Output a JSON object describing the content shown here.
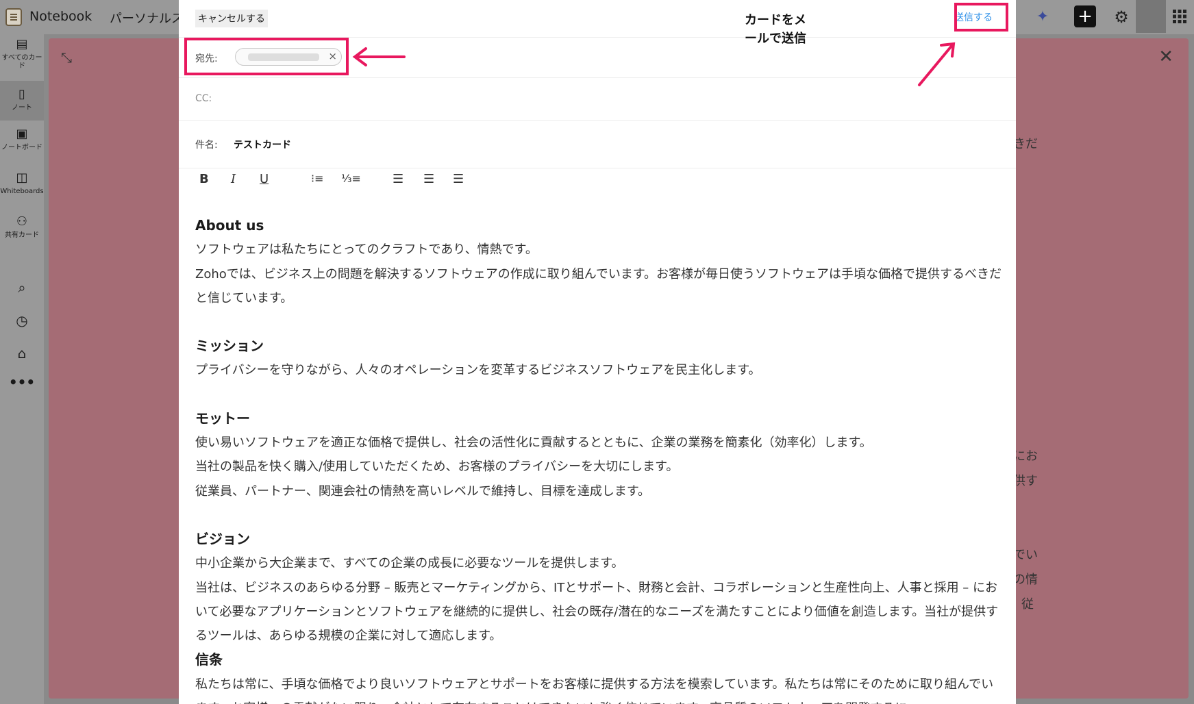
{
  "app": {
    "name": "Notebook",
    "space": "パーソナルスペ"
  },
  "sidebar": {
    "items": [
      {
        "label": "すべてのカード",
        "icon": "all-cards-icon"
      },
      {
        "label": "ノート",
        "icon": "note-icon"
      },
      {
        "label": "ノートボード",
        "icon": "noteboard-icon"
      },
      {
        "label": "Whiteboards",
        "icon": "whiteboard-icon"
      },
      {
        "label": "共有カード",
        "icon": "shared-icon"
      }
    ],
    "tools": [
      "search-icon",
      "alarm-icon",
      "tag-icon",
      "more-icon"
    ]
  },
  "background_card": {
    "fragments": [
      "きだ",
      "にお",
      "供す",
      "でい",
      "の情",
      "従"
    ]
  },
  "compose": {
    "cancel_label": "キャンセルする",
    "send_label": "送信する",
    "to_label": "宛先:",
    "cc_label": "CC:",
    "subject_label": "件名:",
    "subject_value": "テストカード",
    "recipient_chip_remove": "×",
    "toolbar": [
      "bold-icon",
      "italic-icon",
      "underline-icon",
      "bullet-list-icon",
      "numbered-list-icon",
      "align-left-icon",
      "align-center-icon",
      "align-right-icon"
    ],
    "body": {
      "about_heading": "About us",
      "about_p1": "ソフトウェアは私たちにとってのクラフトであり、情熱です。",
      "about_p2": "Zohoでは、ビジネス上の問題を解決するソフトウェアの作成に取り組んでいます。お客様が毎日使うソフトウェアは手頃な価格で提供するべきだと信じています。",
      "mission_heading": "ミッション",
      "mission_p1": "プライバシーを守りながら、人々のオペレーションを変革するビジネスソフトウェアを民主化します。",
      "motto_heading": "モットー",
      "motto_p1": "使い易いソフトウェアを適正な価格で提供し、社会の活性化に貢献するとともに、企業の業務を簡素化（効率化）します。",
      "motto_p2": "当社の製品を快く購入/使用していただくため、お客様のプライバシーを大切にします。",
      "motto_p3": "従業員、パートナー、関連会社の情熱を高いレベルで維持し、目標を達成します。",
      "vision_heading": "ビジョン",
      "vision_p1": "中小企業から大企業まで、すべての企業の成長に必要なツールを提供します。",
      "vision_p2": "当社は、ビジネスのあらゆる分野 – 販売とマーケティングから、ITとサポート、財務と会計、コラボレーションと生産性向上、人事と採用 – において必要なアプリケーションとソフトウェアを継続的に提供し、社会の既存/潜在的なニーズを満たすことにより価値を創造します。当社が提供するツールは、あらゆる規模の企業に対して適応します。",
      "belief_heading": "信条",
      "belief_p1": "私たちは常に、手頃な価格でより良いソフトウェアとサポートをお客様に提供する方法を模索しています。私たちは常にそのために取り組んでいます。お客様への貢献がない限り、会社として存在することはできないと強く信じています。高品質のソフトウェアを開発するに"
    }
  },
  "annotation": {
    "text": "カードをメ\nールで送信",
    "color": "#e8185e"
  }
}
